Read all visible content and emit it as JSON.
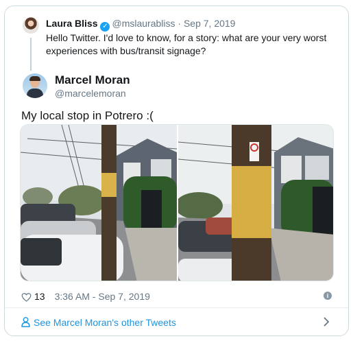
{
  "parent_tweet": {
    "author_name": "Laura Bliss",
    "handle": "@mslaurabliss",
    "separator": "·",
    "date": "Sep 7, 2019",
    "text": "Hello Twitter. I'd love to know, for a story: what are your very worst experiences with bus/transit signage?",
    "verified": true
  },
  "tweet": {
    "author_name": "Marcel Moran",
    "handle": "@marcelemoran",
    "text": "My local stop in Potrero :(",
    "photo_count": 2
  },
  "metrics": {
    "likes": "13",
    "timestamp": "3:36 AM - Sep 7, 2019"
  },
  "footer": {
    "see_more_label": "See Marcel Moran's other Tweets"
  },
  "icons": {
    "like": "heart-icon",
    "info": "info-icon",
    "user": "user-icon",
    "chevron": "chevron-right-icon",
    "verified": "verified-badge-icon"
  },
  "colors": {
    "link": "#1b95e0",
    "verified": "#1da1f2",
    "muted": "#657786",
    "border": "#cfd9de"
  }
}
